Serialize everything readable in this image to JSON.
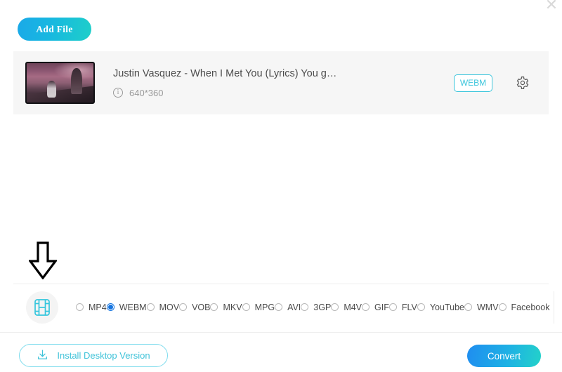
{
  "window": {
    "close_glyph": "✕"
  },
  "toolbar": {
    "add_file_label": "Add File"
  },
  "file": {
    "title": "Justin Vasquez - When I Met You (Lyrics) You g…",
    "info_icon": "info-circle-icon",
    "resolution": "640*360",
    "format_badge": "WEBM",
    "settings_icon": "gear-icon",
    "thumbnail_alt": "video-thumbnail"
  },
  "annotation": {
    "arrow_icon": "down-arrow-annotation"
  },
  "format_bar": {
    "video_icon": "film-strip-icon",
    "audio_icon": "music-note-icon",
    "selected": "WEBM",
    "options": [
      {
        "label": "MP4",
        "selected": false
      },
      {
        "label": "WEBM",
        "selected": true
      },
      {
        "label": "MOV",
        "selected": false
      },
      {
        "label": "VOB",
        "selected": false
      },
      {
        "label": "MKV",
        "selected": false
      },
      {
        "label": "MPG",
        "selected": false
      },
      {
        "label": "AVI",
        "selected": false
      },
      {
        "label": "3GP",
        "selected": false
      },
      {
        "label": "M4V",
        "selected": false
      },
      {
        "label": "GIF",
        "selected": false
      },
      {
        "label": "FLV",
        "selected": false
      },
      {
        "label": "YouTube",
        "selected": false
      },
      {
        "label": "WMV",
        "selected": false
      },
      {
        "label": "Facebook",
        "selected": false
      }
    ]
  },
  "footer": {
    "install_label": "Install Desktop Version",
    "install_icon": "download-icon",
    "convert_label": "Convert"
  },
  "colors": {
    "accent_cyan": "#3ec6dc",
    "accent_blue": "#1f8df0",
    "radio_selected": "#1675e0",
    "card_bg": "#f6f6f6",
    "text_primary": "#4c4c4c",
    "text_muted": "#9a9a9a"
  }
}
